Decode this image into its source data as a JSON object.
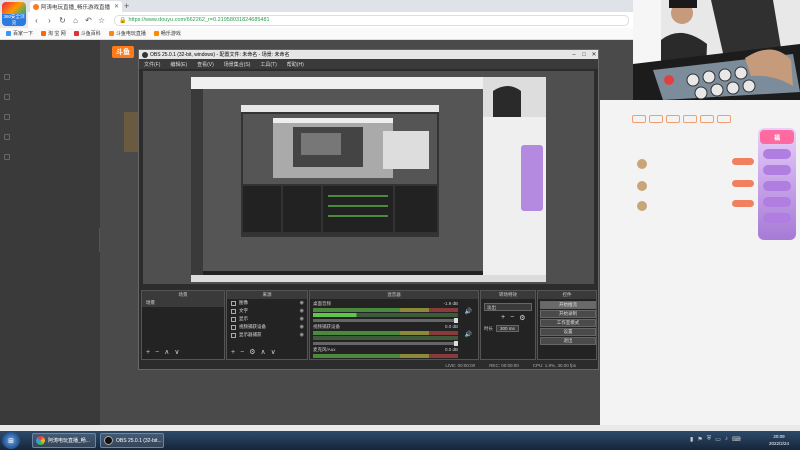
{
  "browser": {
    "logo_label": "360安全浏览",
    "tab_title": "阿涛电玩直播_畅乐游戏直播",
    "url": "https://www.douyu.com/662262_r=0.21958031824685481",
    "bookmarks": [
      "百家一下",
      "淘 宝 网",
      "斗鱼百科",
      "斗鱼电玩直播",
      "畅乐游戏"
    ]
  },
  "obs": {
    "title": "OBS 25.0.1 (32-bit, windows) - 配置文件: 未命名 - 场景: 未命名",
    "menu": [
      "文件(F)",
      "编辑(E)",
      "查看(V)",
      "场景集合(S)",
      "工具(T)",
      "帮助(H)"
    ],
    "panels": {
      "scenes": "场景",
      "sources": "来源",
      "mixer": "混音器",
      "transitions": "转场特效",
      "controls": "控件"
    },
    "scenes_list": [
      "场景"
    ],
    "sources_list": [
      "图像",
      "文字",
      "显示",
      "视频捕获设备",
      "显示器捕获"
    ],
    "mixer_rows": [
      {
        "name": "桌面音频",
        "db": "-1.9 dB"
      },
      {
        "name": "视频捕获设备",
        "db": "0.0 dB"
      },
      {
        "name": "麦克风/Aux",
        "db": "0.0 dB"
      }
    ],
    "transition": {
      "type": "淡出",
      "duration_label": "时长",
      "duration": "300 ms"
    },
    "controls_buttons": [
      "开始推流",
      "开始录制",
      "工作室模式",
      "设置",
      "退出"
    ],
    "status": {
      "live": "LIVE: 00:00:00",
      "rec": "REC: 00:00:00",
      "cpu": "CPU: 1.9%, 30.00 fps"
    }
  },
  "taskbar": {
    "items": [
      "阿涛电玩直播_畅...",
      "OBS 25.0.1 (32-bit..."
    ],
    "time": "20:09",
    "date": "2022/2/24"
  },
  "colors": {
    "accent": "#ff7a19",
    "sidebar": "#3a3a3a",
    "obs_bg": "#2c2c2c"
  }
}
